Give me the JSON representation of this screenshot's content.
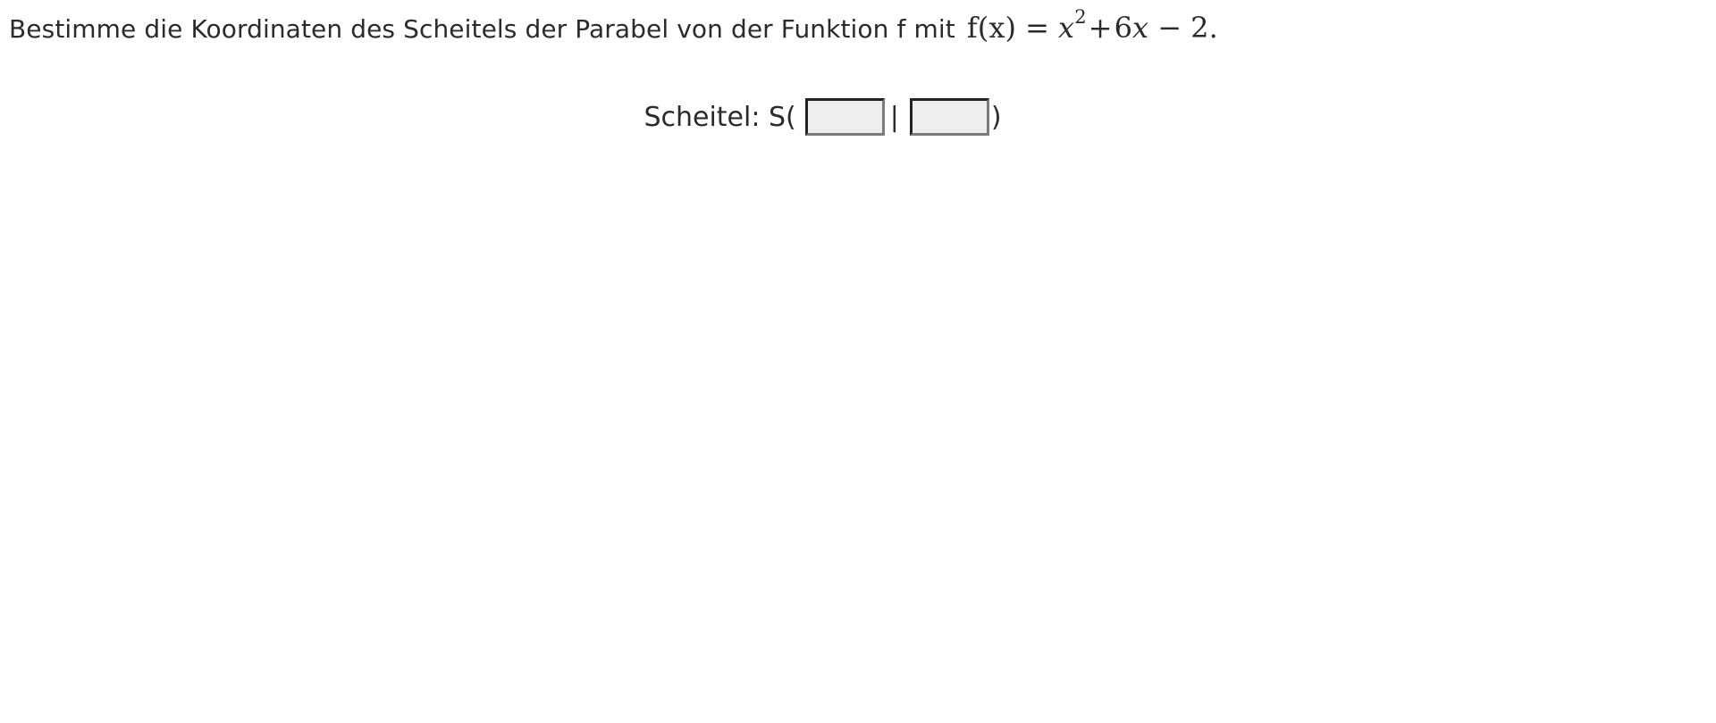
{
  "question": {
    "text": "Bestimme die Koordinaten des Scheitels der Parabel von der Funktion f mit",
    "formula": {
      "lhs_name": "f",
      "lhs_open": "(",
      "lhs_var": "x",
      "lhs_close": ")",
      "equals": "=",
      "term1_var": "x",
      "term1_exp": "2",
      "plus": "+",
      "term2_coef": "6",
      "term2_var": "x",
      "minus": "−",
      "constant": "2",
      "end": "."
    }
  },
  "answer": {
    "label": "Scheitel: S(",
    "x_value": "",
    "separator": "|",
    "y_value": "",
    "close": ")"
  }
}
